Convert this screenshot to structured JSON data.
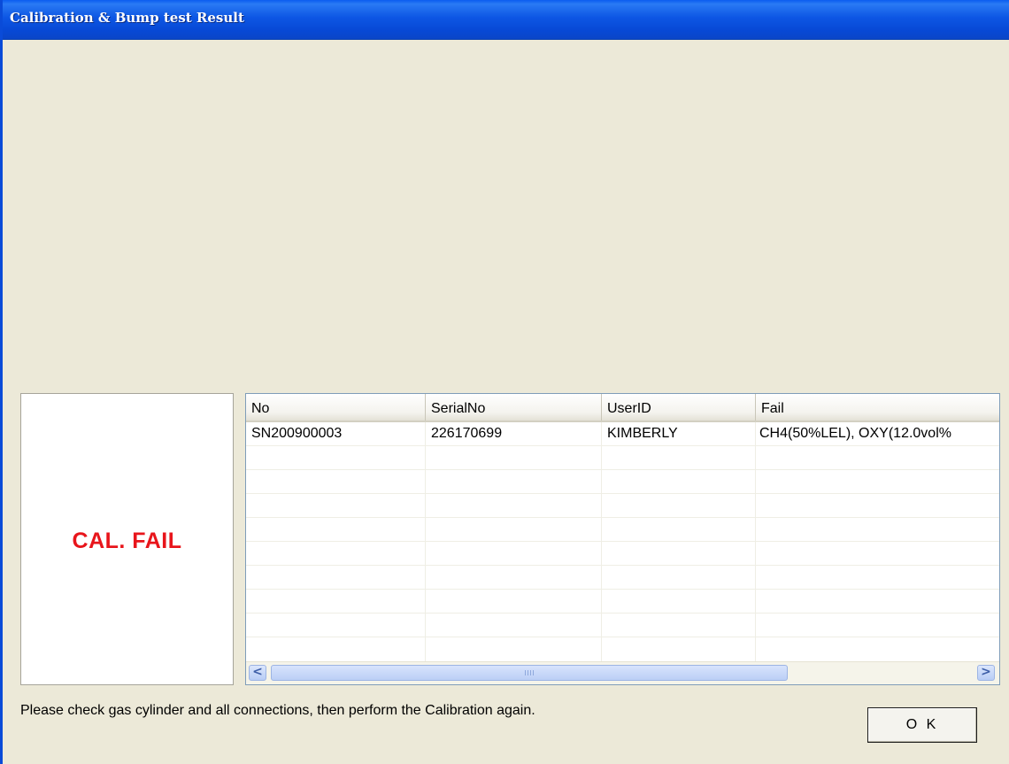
{
  "window": {
    "title": "Calibration & Bump test Result"
  },
  "result": {
    "status_text": "CAL. FAIL",
    "status_color": "#e8151b"
  },
  "grid": {
    "columns": [
      "No",
      "SerialNo",
      "UserID",
      "Fail"
    ],
    "rows": [
      [
        "SN200900003",
        "226170699",
        "KIMBERLY",
        "CH4(50%LEL), OXY(12.0vol%"
      ]
    ]
  },
  "message": "Please check gas cylinder and all connections, then perform the Calibration again.",
  "buttons": {
    "ok_label": "O K"
  },
  "scrollbar": {
    "left_arrow": "<",
    "right_arrow": ">"
  }
}
